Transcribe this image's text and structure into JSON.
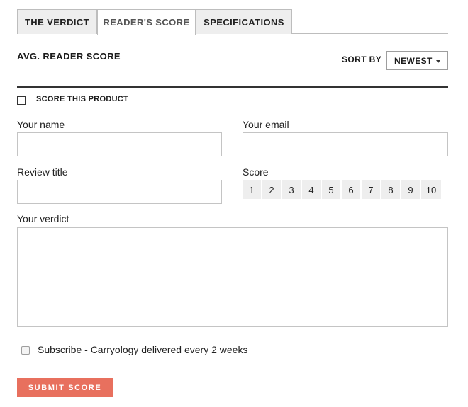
{
  "tabs": {
    "verdict": "THE VERDICT",
    "reader_score": "READER'S SCORE",
    "specifications": "SPECIFICATIONS",
    "active": "reader_score"
  },
  "header": {
    "avg_label": "AVG. READER SCORE",
    "sort_label": "SORT BY",
    "sort_value": "NEWEST"
  },
  "form": {
    "section_title": "SCORE THIS PRODUCT",
    "name_label": "Your name",
    "name_value": "",
    "email_label": "Your email",
    "email_value": "",
    "title_label": "Review title",
    "title_value": "",
    "score_label": "Score",
    "score_options": [
      "1",
      "2",
      "3",
      "4",
      "5",
      "6",
      "7",
      "8",
      "9",
      "10"
    ],
    "verdict_label": "Your verdict",
    "verdict_value": "",
    "subscribe_label": "Subscribe - Carryology delivered every 2 weeks",
    "subscribe_checked": false,
    "submit_label": "SUBMIT SCORE"
  },
  "colors": {
    "accent": "#e8705e",
    "tab_inactive": "#eeeeee",
    "score_button": "#eeeeee",
    "border": "#c4c4c4"
  }
}
